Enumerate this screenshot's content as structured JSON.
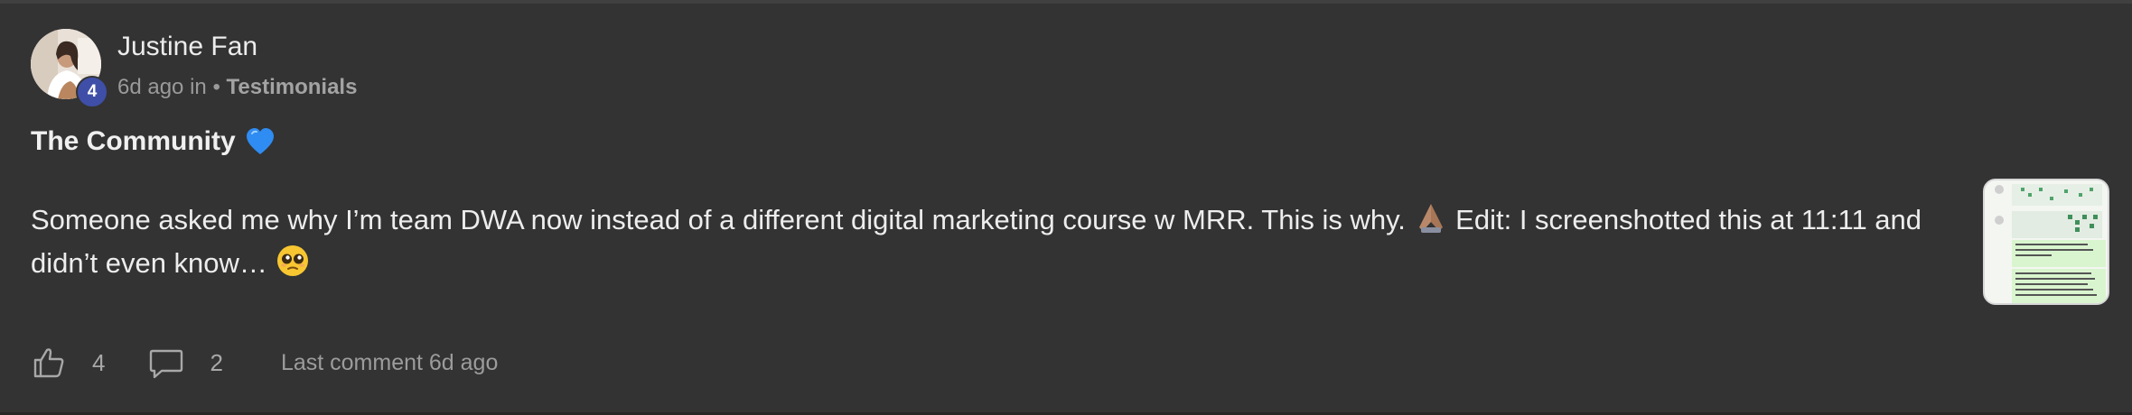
{
  "author": {
    "name": "Justine Fan",
    "level": "4",
    "avatar_icon": "user-avatar-photo"
  },
  "meta": {
    "time": "6d ago",
    "in_text": "in",
    "separator": "•",
    "category": "Testimonials"
  },
  "post": {
    "title": "The Community",
    "title_emoji": "blue-heart-icon",
    "body_part1": "Someone asked me why I’m team DWA now instead of a different digital marketing course w MRR. This is why.",
    "body_emoji1": "folded-hands-icon",
    "body_part2": " Edit: I screenshotted this at 11:11 and didn’t even know…",
    "body_emoji2": "pleading-face-icon",
    "attachment_icon": "screenshot-thumbnail"
  },
  "footer": {
    "like_icon": "thumbs-up-icon",
    "like_count": "4",
    "comment_icon": "comment-bubble-icon",
    "comment_count": "2",
    "last_comment": "Last comment 6d ago"
  },
  "colors": {
    "background": "#333333",
    "badge": "#3f4fa8",
    "text_primary": "#ececec",
    "text_secondary": "#9a9a9a",
    "heart": "#2f8cf2"
  }
}
